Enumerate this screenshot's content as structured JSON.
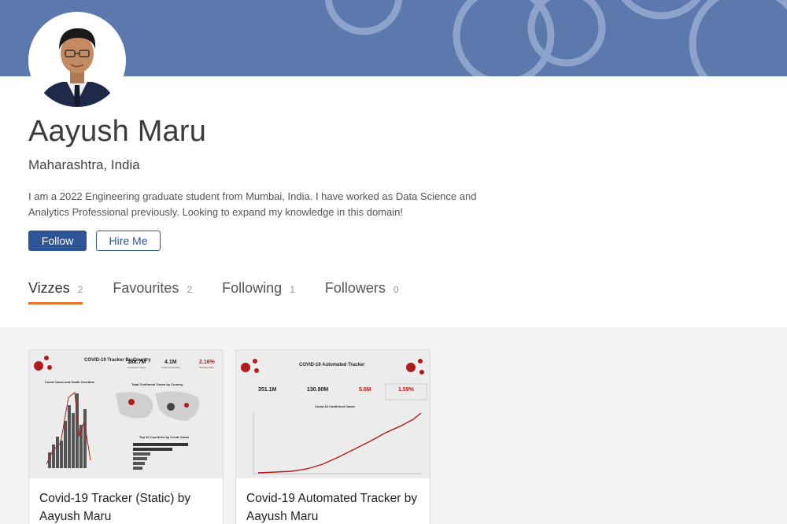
{
  "profile": {
    "name": "Aayush Maru",
    "location": "Maharashtra, India",
    "bio": "I am a 2022 Engineering graduate student from Mumbai, India. I have worked as Data Science and Analytics Professional previously. Looking to expand my knowledge in this domain!"
  },
  "actions": {
    "follow_label": "Follow",
    "hire_label": "Hire Me"
  },
  "tabs": [
    {
      "label": "Vizzes",
      "count": "2",
      "active": true
    },
    {
      "label": "Favourites",
      "count": "2",
      "active": false
    },
    {
      "label": "Following",
      "count": "1",
      "active": false
    },
    {
      "label": "Followers",
      "count": "0",
      "active": false
    }
  ],
  "cards": [
    {
      "title": "Covid-19 Tracker (Static) by Aayush Maru",
      "thumb": {
        "heading": "COVID-19 Tracker By Country",
        "stat1": "188.7M",
        "stat1_label": "Confirmed Cases",
        "stat2": "4.1M",
        "stat2_label": "Confirmed Deaths",
        "stat3": "2.16%",
        "stat3_label": "Mortality Rate",
        "left_title": "Covid Cases and Death Overtime",
        "map_title": "Total Confirmed Cases by Country",
        "bar_title": "Top 10 Countries by Covid Cases"
      }
    },
    {
      "title": "Covid-19 Automated Tracker by Aayush Maru",
      "thumb": {
        "heading": "COVID-19 Automated Tracker",
        "stat1": "351.1M",
        "stat2": "130.90M",
        "stat3": "5.6M",
        "stat4": "1.59%",
        "chart_title": "Covid-19 Confirmed Cases"
      }
    }
  ],
  "colors": {
    "banner": "#5b79ad",
    "primary": "#2d5596",
    "accent_tab": "#e8762d",
    "virus_red": "#b01c1c"
  }
}
